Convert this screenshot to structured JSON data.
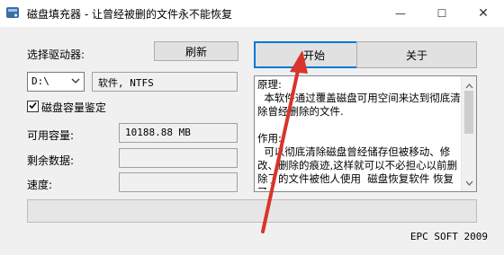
{
  "window": {
    "title": "磁盘填充器 - 让曾经被删的文件永不能恢复",
    "minimize_glyph": "—",
    "maximize_glyph": "☐",
    "close_glyph": "✕"
  },
  "drive": {
    "label": "选择驱动器:",
    "refresh_label": "刷新",
    "selected": "D:\\",
    "info": "软件, NTFS"
  },
  "capacity": {
    "checkbox_label": "磁盘容量鉴定",
    "checked": true,
    "available_label": "可用容量:",
    "available_value": "10188.88 MB",
    "remaining_label": "剩余数据:",
    "remaining_value": "",
    "speed_label": "速度:",
    "speed_value": ""
  },
  "actions": {
    "start_label": "开始",
    "about_label": "关于"
  },
  "description": {
    "text": "原理:\n  本软件通过覆盖磁盘可用空间来达到彻底清除曾经删除的文件.\n\n作用:\n  可以彻底清除磁盘曾经储存但被移动、修改、删除的痕迹,这样就可以不必担心以前删除了的文件被他人使用  磁盘恢复软件 恢复了."
  },
  "progress": {
    "value": 0
  },
  "footer": {
    "text": "EPC SOFT 2009"
  },
  "icons": {
    "app": "disk-fill-app-icon",
    "minimize": "minimize-icon",
    "maximize": "maximize-icon",
    "close": "close-icon",
    "dropdown": "chevron-down-icon",
    "checkmark": "checkmark-icon"
  },
  "colors": {
    "annotation_arrow": "#d9342b",
    "focus_border": "#0078d7"
  }
}
